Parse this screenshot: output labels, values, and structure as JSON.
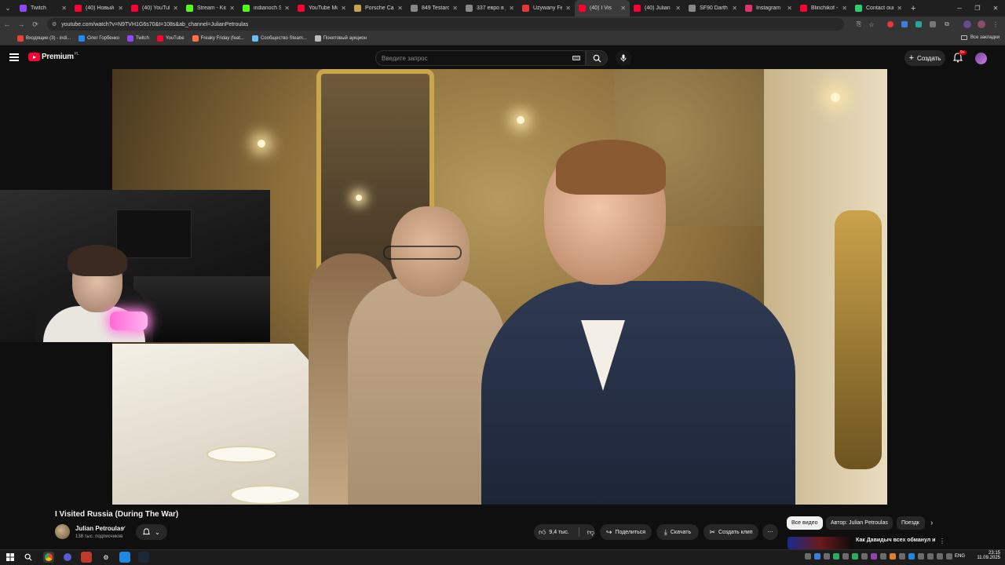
{
  "browser": {
    "tabs": [
      {
        "label": "Twitch",
        "color": "#9146ff"
      },
      {
        "label": "(40) Новый ф",
        "color": "#ff0033"
      },
      {
        "label": "(40) YouTube",
        "color": "#ff0033"
      },
      {
        "label": "Stream - Kick",
        "color": "#53fc18"
      },
      {
        "label": "indianoch Str",
        "color": "#53fc18"
      },
      {
        "label": "YouTube Mus",
        "color": "#ff0033"
      },
      {
        "label": "Porsche Car C",
        "color": "#c8a24a"
      },
      {
        "label": "849 Testaros",
        "color": "#888888"
      },
      {
        "label": "337 евро в д",
        "color": "#888888"
      },
      {
        "label": "Używany Fer",
        "color": "#e53935"
      },
      {
        "label": "(40) I Vis",
        "color": "#ff0033"
      },
      {
        "label": "(40) Julian Pe",
        "color": "#ff0033"
      },
      {
        "label": "SF90 Darth V",
        "color": "#888888"
      },
      {
        "label": "Instagram",
        "color": "#e1306c"
      },
      {
        "label": "Blinchikof - Y",
        "color": "#ff0033"
      },
      {
        "label": "Contact our t",
        "color": "#2ecc71"
      }
    ],
    "active_tab_index": 10,
    "url": "youtube.com/watch?v=N9TVH1G6s70&t=108s&ab_channel=JulianPetroulas",
    "bookmarks": [
      {
        "label": "Входящие (3) - indi...",
        "color": "#ea4335"
      },
      {
        "label": "Олег Горбенко",
        "color": "#2787f5"
      },
      {
        "label": "Twitch",
        "color": "#9146ff"
      },
      {
        "label": "YouTube",
        "color": "#ff0033"
      },
      {
        "label": "Freaky Friday (feat...",
        "color": "#ff7043"
      },
      {
        "label": "Сообщество Steam...",
        "color": "#66c0f4"
      },
      {
        "label": "Понятовый аукцион",
        "color": "#bbbbbb"
      }
    ],
    "all_bookmarks": "Все закладки"
  },
  "youtube": {
    "logo_text": "Premium",
    "logo_badge": "PL",
    "search_placeholder": "Введите запрос",
    "create_label": "Создать",
    "notif_badge": "9+"
  },
  "video": {
    "title": "I Visited Russia (During The War)",
    "channel": "Julian Petroulas",
    "subscribers": "138 тыс. подписчиков",
    "likes": "9,4 тыс.",
    "share_label": "Поделиться",
    "download_label": "Скачать",
    "clip_label": "Создать клип"
  },
  "sidebar": {
    "chips": [
      "Все видео",
      "Автор: Julian Petroulas",
      "Поездк"
    ],
    "recommended_title": "Как Давидыч всех обманул и"
  },
  "taskbar": {
    "lang": "ENG",
    "time": "23:15",
    "date": "11.09.2025"
  }
}
